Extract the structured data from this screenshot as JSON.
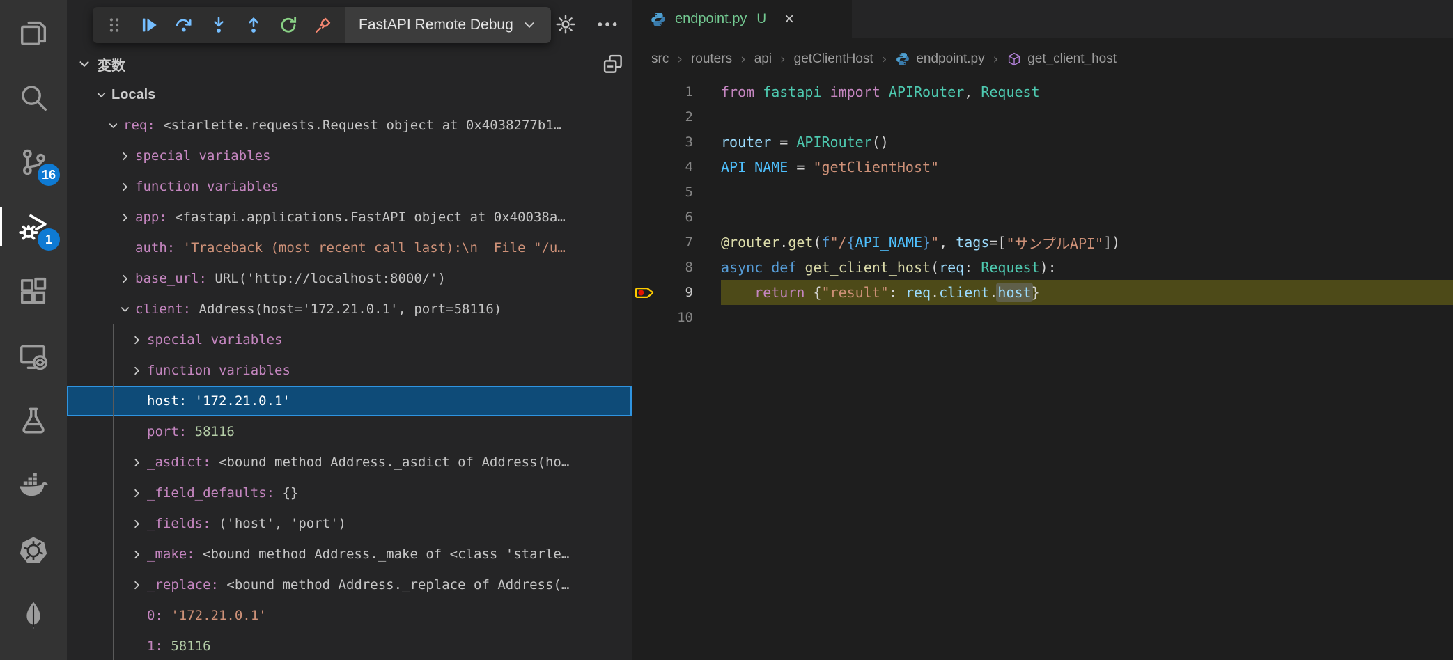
{
  "colors": {
    "badge_blue": "#0e7ad3",
    "selection_bg": "#0e4b78",
    "selection_border": "#2f94e0",
    "debug_line_highlight": "#4d4a18",
    "tab_untracked_green": "#73c991",
    "variable_name_pink": "#c586c0",
    "string_orange": "#ce9178",
    "number_green": "#b5cea8",
    "debug_icon_blue": "#75beff",
    "restart_green": "#89d185",
    "disconnect_red": "#f48771"
  },
  "activity_bar": {
    "items": [
      {
        "id": "explorer",
        "badge": null,
        "active": false
      },
      {
        "id": "search",
        "badge": null,
        "active": false
      },
      {
        "id": "source-control",
        "badge": "16",
        "active": false
      },
      {
        "id": "run-debug",
        "badge": "1",
        "active": true
      },
      {
        "id": "extensions",
        "badge": null,
        "active": false
      },
      {
        "id": "remote-explorer",
        "badge": null,
        "active": false
      },
      {
        "id": "testing",
        "badge": null,
        "active": false
      },
      {
        "id": "docker",
        "badge": null,
        "active": false
      },
      {
        "id": "kubernetes",
        "badge": null,
        "active": false
      },
      {
        "id": "mongodb",
        "badge": null,
        "active": false
      }
    ]
  },
  "debug_toolbar": {
    "buttons": [
      {
        "id": "drag-handle"
      },
      {
        "id": "continue"
      },
      {
        "id": "step-over"
      },
      {
        "id": "step-into"
      },
      {
        "id": "step-out"
      },
      {
        "id": "restart"
      },
      {
        "id": "disconnect"
      }
    ],
    "config_label": "FastAPI Remote Debug",
    "title_actions": [
      {
        "id": "gear"
      },
      {
        "id": "ellipsis"
      }
    ]
  },
  "sidebar": {
    "panel_title": "変数",
    "rows": [
      {
        "level": 0,
        "twistie": "down",
        "kind": "scope",
        "name": "Locals"
      },
      {
        "level": 1,
        "twistie": "down",
        "kind": "var",
        "name": "req",
        "value": "<starlette.requests.Request object at 0x4038277b1…",
        "vc": "obj"
      },
      {
        "level": 2,
        "twistie": "right",
        "kind": "group",
        "name": "special variables"
      },
      {
        "level": 2,
        "twistie": "right",
        "kind": "group",
        "name": "function variables"
      },
      {
        "level": 2,
        "twistie": "right",
        "kind": "var",
        "name": "app",
        "value": "<fastapi.applications.FastAPI object at 0x40038a…",
        "vc": "obj"
      },
      {
        "level": 2,
        "twistie": "none",
        "kind": "var",
        "name": "auth",
        "value": "'Traceback (most recent call last):\\n  File \"/u…",
        "vc": "str"
      },
      {
        "level": 2,
        "twistie": "right",
        "kind": "var",
        "name": "base_url",
        "value": "URL('http://localhost:8000/')",
        "vc": "obj"
      },
      {
        "level": 2,
        "twistie": "down",
        "kind": "var",
        "name": "client",
        "value": "Address(host='172.21.0.1', port=58116)",
        "vc": "obj"
      },
      {
        "level": 3,
        "twistie": "right",
        "kind": "group",
        "name": "special variables"
      },
      {
        "level": 3,
        "twistie": "right",
        "kind": "group",
        "name": "function variables"
      },
      {
        "level": 3,
        "twistie": "none",
        "kind": "var",
        "name": "host",
        "value": "'172.21.0.1'",
        "vc": "white",
        "selected": true
      },
      {
        "level": 3,
        "twistie": "none",
        "kind": "var",
        "name": "port",
        "value": "58116",
        "vc": "num"
      },
      {
        "level": 3,
        "twistie": "right",
        "kind": "var",
        "name": "_asdict",
        "value": "<bound method Address._asdict of Address(ho…",
        "vc": "obj"
      },
      {
        "level": 3,
        "twistie": "right",
        "kind": "var",
        "name": "_field_defaults",
        "value": "{}",
        "vc": "obj"
      },
      {
        "level": 3,
        "twistie": "right",
        "kind": "var",
        "name": "_fields",
        "value": "('host', 'port')",
        "vc": "obj"
      },
      {
        "level": 3,
        "twistie": "right",
        "kind": "var",
        "name": "_make",
        "value": "<bound method Address._make of <class 'starle…",
        "vc": "obj"
      },
      {
        "level": 3,
        "twistie": "right",
        "kind": "var",
        "name": "_replace",
        "value": "<bound method Address._replace of Address(…",
        "vc": "obj"
      },
      {
        "level": 3,
        "twistie": "none",
        "kind": "var",
        "name": "0",
        "value": "'172.21.0.1'",
        "vc": "str"
      },
      {
        "level": 3,
        "twistie": "none",
        "kind": "var",
        "name": "1",
        "value": "58116",
        "vc": "num"
      }
    ]
  },
  "editor": {
    "tab": {
      "icon": "python",
      "label": "endpoint.py",
      "badge": "U",
      "close": "×"
    },
    "breadcrumb": [
      {
        "label": "src"
      },
      {
        "label": "routers"
      },
      {
        "label": "api"
      },
      {
        "label": "getClientHost"
      },
      {
        "label": "endpoint.py",
        "icon": "python"
      },
      {
        "label": "get_client_host",
        "icon": "symbol-method"
      }
    ],
    "code": {
      "current_line": 9,
      "breakpoint_line": 9,
      "lines": [
        {
          "n": 1,
          "tokens": [
            [
              "from",
              "kw"
            ],
            [
              " ",
              "pl"
            ],
            [
              "fastapi",
              "ty"
            ],
            [
              " ",
              "pl"
            ],
            [
              "import",
              "kw"
            ],
            [
              " ",
              "pl"
            ],
            [
              "APIRouter",
              "ty"
            ],
            [
              ", ",
              "pl"
            ],
            [
              "Request",
              "ty"
            ]
          ]
        },
        {
          "n": 2,
          "tokens": []
        },
        {
          "n": 3,
          "tokens": [
            [
              "router",
              "va"
            ],
            [
              " = ",
              "pl"
            ],
            [
              "APIRouter",
              "ty"
            ],
            [
              "()",
              "pl"
            ]
          ]
        },
        {
          "n": 4,
          "tokens": [
            [
              "API_NAME",
              "co"
            ],
            [
              " = ",
              "pl"
            ],
            [
              "\"getClientHost\"",
              "st"
            ]
          ]
        },
        {
          "n": 5,
          "tokens": []
        },
        {
          "n": 6,
          "tokens": []
        },
        {
          "n": 7,
          "tokens": [
            [
              "@router",
              "fn"
            ],
            [
              ".",
              "pl"
            ],
            [
              "get",
              "fn"
            ],
            [
              "(",
              "pl"
            ],
            [
              "f",
              "kwb"
            ],
            [
              "\"/",
              "st"
            ],
            [
              "{",
              "kwb"
            ],
            [
              "API_NAME",
              "co"
            ],
            [
              "}",
              "kwb"
            ],
            [
              "\"",
              "st"
            ],
            [
              ", ",
              "pl"
            ],
            [
              "tags",
              "va"
            ],
            [
              "=[",
              "pl"
            ],
            [
              "\"サンプルAPI\"",
              "st"
            ],
            [
              "])",
              "pl"
            ]
          ]
        },
        {
          "n": 8,
          "tokens": [
            [
              "async",
              "kwb"
            ],
            [
              " ",
              "pl"
            ],
            [
              "def",
              "kwb"
            ],
            [
              " ",
              "pl"
            ],
            [
              "get_client_host",
              "fn"
            ],
            [
              "(",
              "pl"
            ],
            [
              "req",
              "va"
            ],
            [
              ": ",
              "pl"
            ],
            [
              "Request",
              "ty"
            ],
            [
              "):",
              "pl"
            ]
          ]
        },
        {
          "n": 9,
          "tokens": [
            [
              "    ",
              "pl"
            ],
            [
              "return",
              "kw"
            ],
            [
              " {",
              "pl"
            ],
            [
              "\"result\"",
              "st"
            ],
            [
              ": ",
              "pl"
            ],
            [
              "req",
              "va"
            ],
            [
              ".",
              "pl"
            ],
            [
              "client",
              "va"
            ],
            [
              ".",
              "pl"
            ],
            [
              "host",
              "va",
              true
            ],
            [
              "}",
              "pl"
            ]
          ]
        },
        {
          "n": 10,
          "tokens": []
        }
      ]
    }
  }
}
